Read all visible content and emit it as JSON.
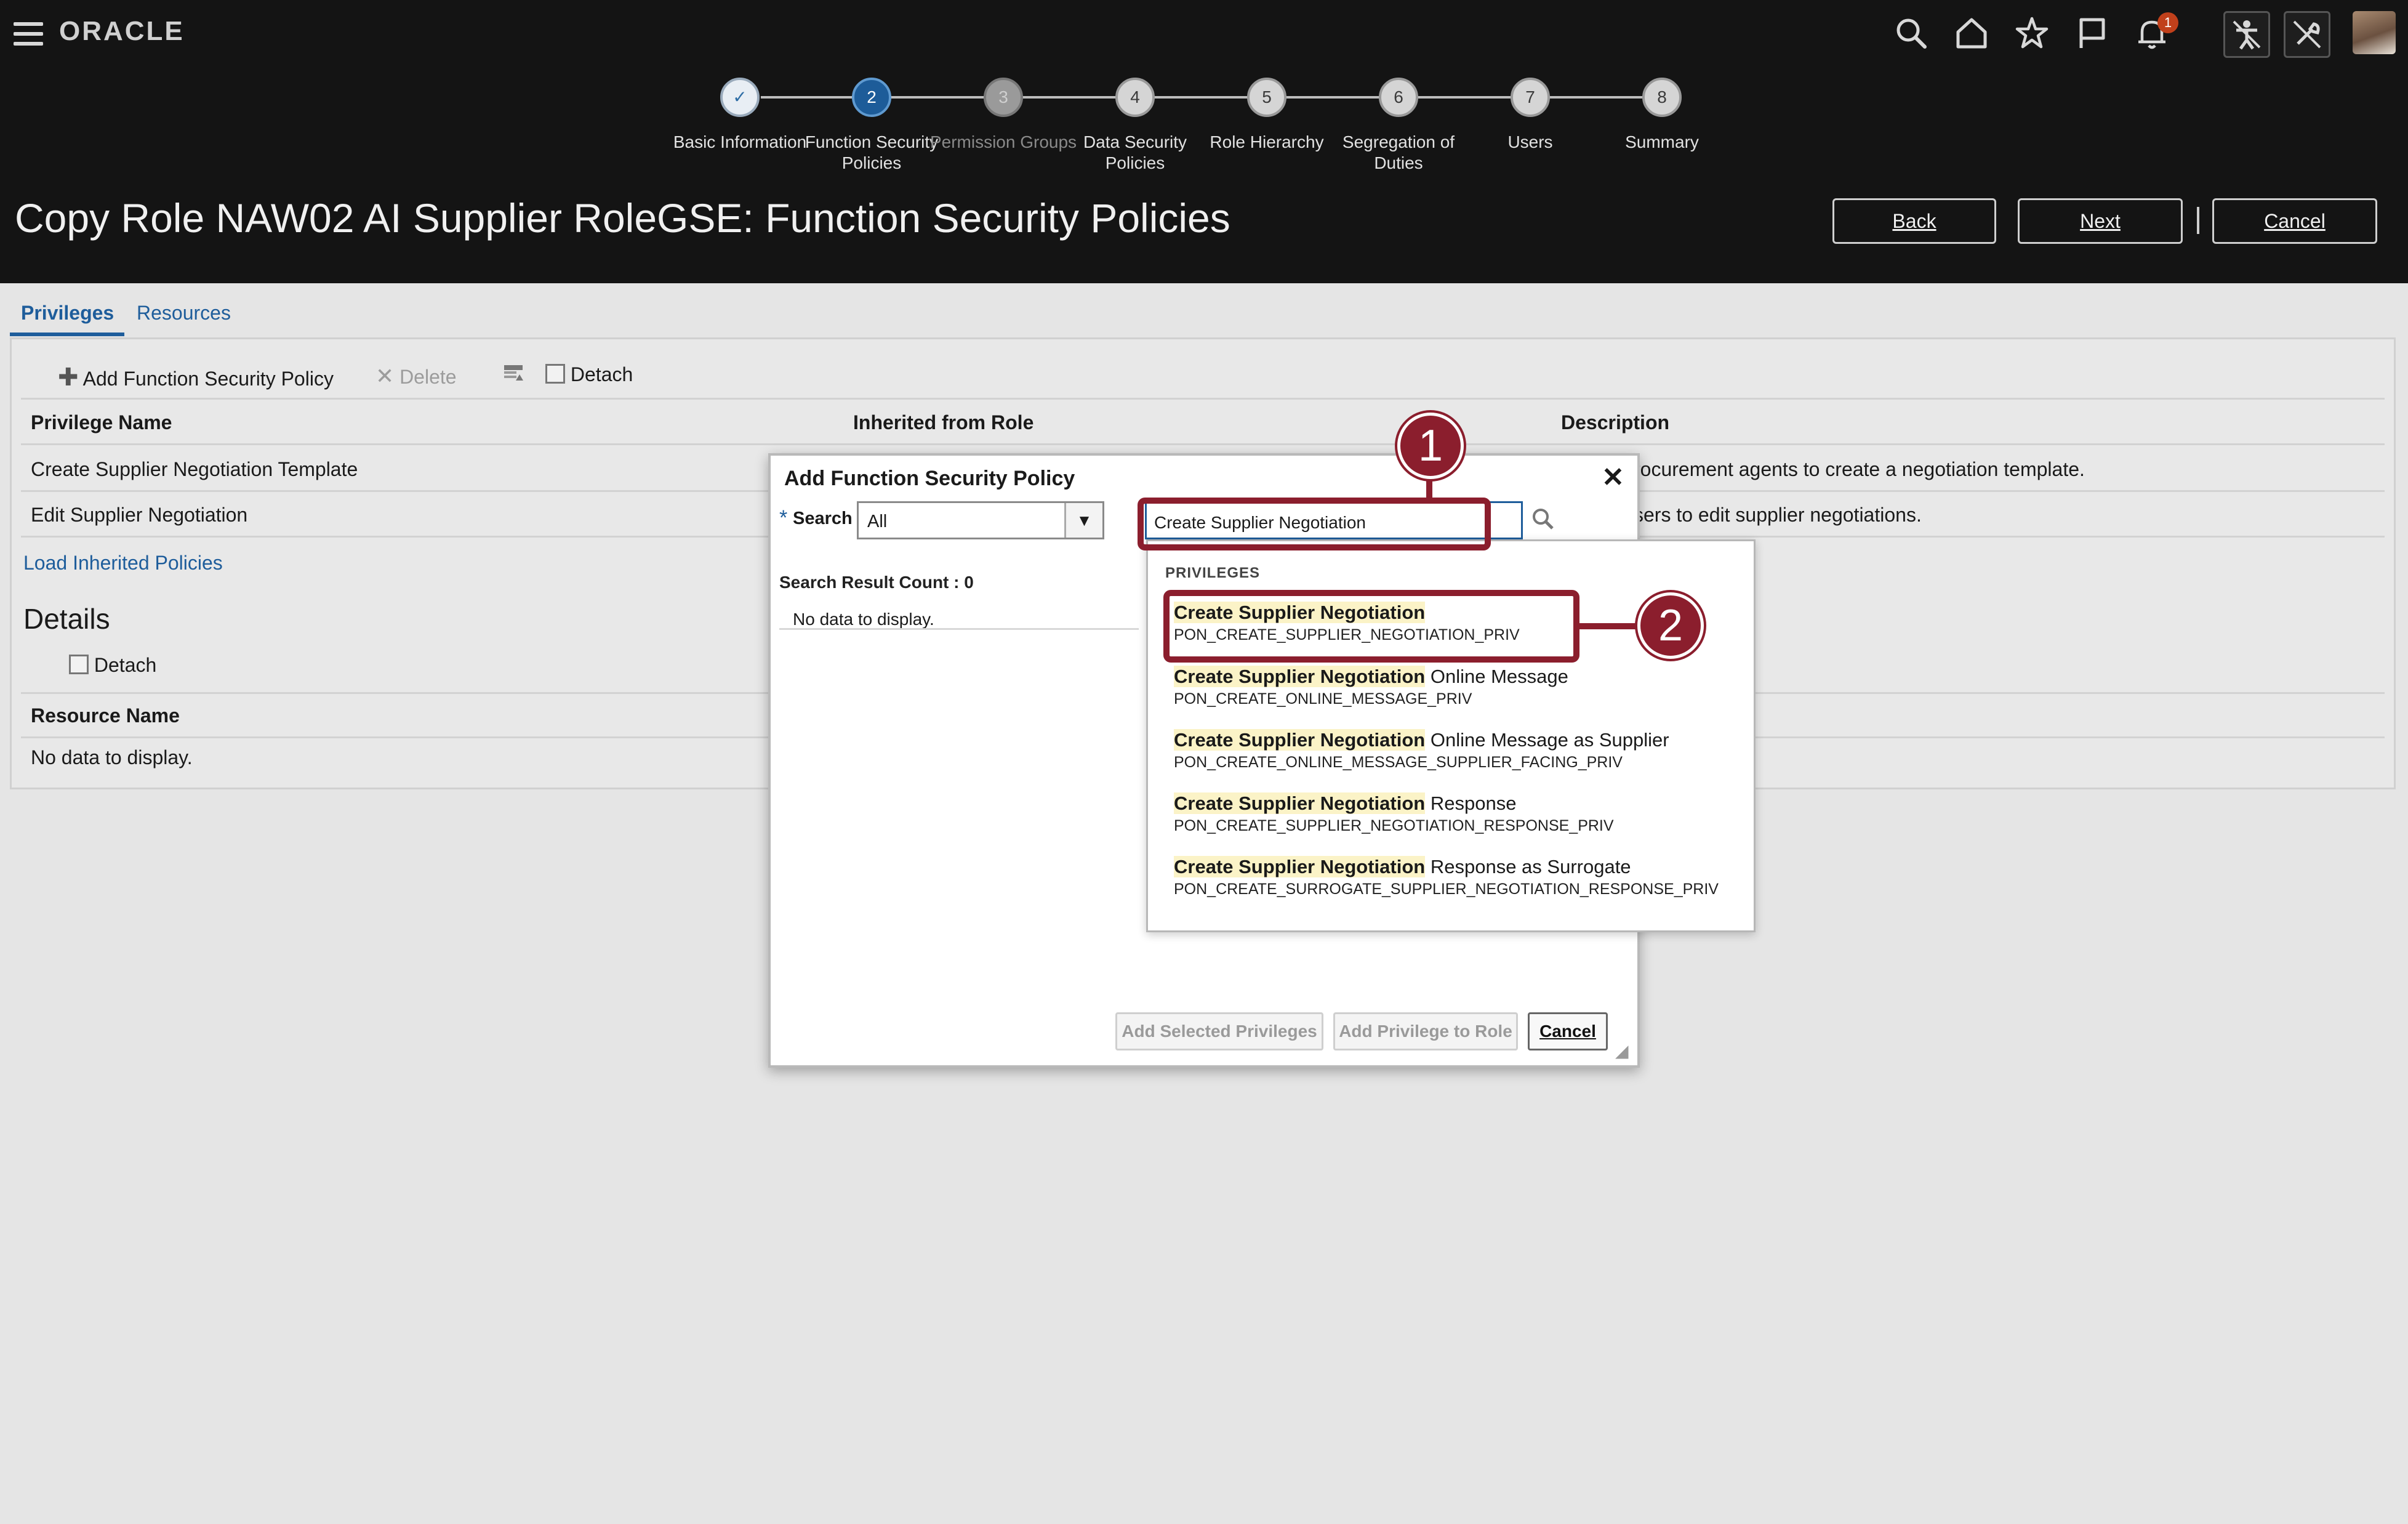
{
  "nav": {
    "logo": "ORACLE",
    "notification_count": "1",
    "icons": [
      "search-icon",
      "home-icon",
      "star-icon",
      "flag-icon",
      "bell-icon",
      "accessibility-icon",
      "settings-icon"
    ]
  },
  "train": {
    "steps": [
      {
        "num": "✓",
        "label": "Basic Information",
        "state": "done"
      },
      {
        "num": "2",
        "label": "Function Security Policies",
        "state": "current"
      },
      {
        "num": "3",
        "label": "Permission Groups",
        "state": "disabled"
      },
      {
        "num": "4",
        "label": "Data Security Policies",
        "state": "normal"
      },
      {
        "num": "5",
        "label": "Role Hierarchy",
        "state": "normal"
      },
      {
        "num": "6",
        "label": "Segregation of Duties",
        "state": "normal"
      },
      {
        "num": "7",
        "label": "Users",
        "state": "normal"
      },
      {
        "num": "8",
        "label": "Summary",
        "state": "normal"
      }
    ]
  },
  "header": {
    "title": "Copy Role NAW02 AI Supplier RoleGSE: Function Security Policies",
    "back": "Back",
    "next": "Next",
    "cancel": "Cancel"
  },
  "tabs": {
    "privileges": "Privileges",
    "resources": "Resources"
  },
  "toolbar": {
    "add": "Add Function Security Policy",
    "delete": "Delete",
    "detach": "Detach"
  },
  "table": {
    "col_privilege": "Privilege Name",
    "col_inherited": "Inherited from Role",
    "col_description": "Description",
    "rows": [
      {
        "name": "Create Supplier Negotiation Template",
        "description": "rocurement agents to create a negotiation template."
      },
      {
        "name": "Edit Supplier Negotiation",
        "description": "sers to edit supplier negotiations."
      }
    ],
    "load_inherited": "Load Inherited Policies"
  },
  "details": {
    "title": "Details",
    "detach": "Detach",
    "col_resource": "Resource Name",
    "no_data": "No data to display."
  },
  "dialog": {
    "title": "Add Function Security Policy",
    "close": "✕",
    "required_mark": "*",
    "search_label": "Search",
    "search_scope": "All",
    "search_value": "Create Supplier Negotiation",
    "result_count": "Search Result Count : 0",
    "no_data": "No data to display.",
    "add_selected": "Add Selected Privileges",
    "add_to_role": "Add Privilege to Role",
    "cancel": "Cancel"
  },
  "dropdown": {
    "heading": "PRIVILEGES",
    "items": [
      {
        "match": "Create Supplier Negotiation",
        "rest": "",
        "code": "PON_CREATE_SUPPLIER_NEGOTIATION_PRIV"
      },
      {
        "match": "Create Supplier Negotiation",
        "rest": " Online Message",
        "code": "PON_CREATE_ONLINE_MESSAGE_PRIV"
      },
      {
        "match": "Create Supplier Negotiation",
        "rest": " Online Message as Supplier",
        "code": "PON_CREATE_ONLINE_MESSAGE_SUPPLIER_FACING_PRIV"
      },
      {
        "match": "Create Supplier Negotiation",
        "rest": " Response",
        "code": "PON_CREATE_SUPPLIER_NEGOTIATION_RESPONSE_PRIV"
      },
      {
        "match": "Create Supplier Negotiation",
        "rest": " Response as Surrogate",
        "code": "PON_CREATE_SURROGATE_SUPPLIER_NEGOTIATION_RESPONSE_PRIV"
      }
    ]
  },
  "callouts": {
    "one": "1",
    "two": "2"
  },
  "colors": {
    "accent": "#1e5d9b",
    "callout": "#8b1e2d",
    "header_bg": "#141414"
  }
}
